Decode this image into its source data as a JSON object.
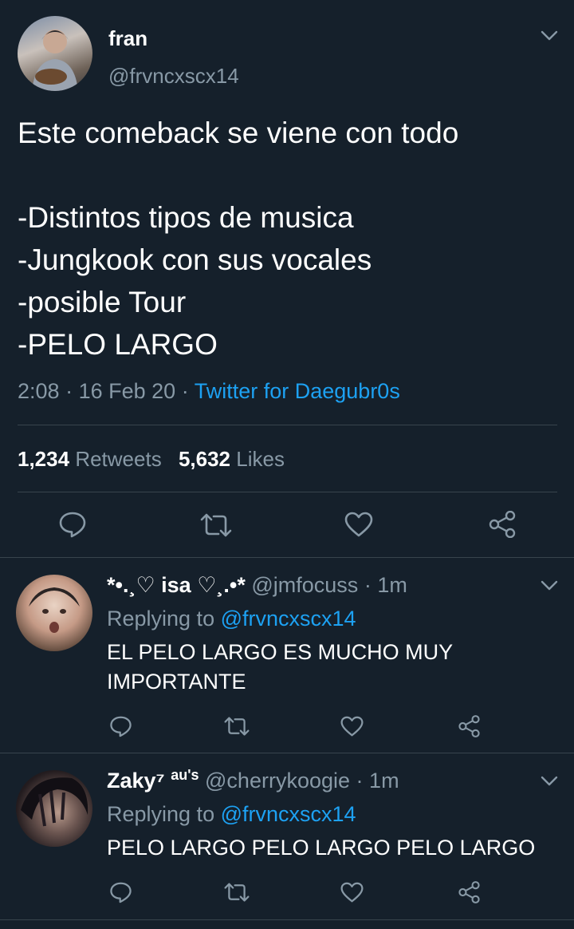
{
  "main_tweet": {
    "author_name": "fran",
    "author_handle": "@frvncxscx14",
    "text_line1": "Este comeback se viene con todo",
    "text_line2": "-Distintos tipos de musica",
    "text_line3": "-Jungkook con sus vocales",
    "text_line4": "-posible Tour",
    "text_line5": "-PELO LARGO",
    "time": "2:08",
    "date": "16 Feb 20",
    "separator": "·",
    "source": "Twitter for Daegubr0s",
    "retweets_count": "1,234",
    "retweets_label": "Retweets",
    "likes_count": "5,632",
    "likes_label": "Likes"
  },
  "replies": [
    {
      "author_name": "*•.¸♡ isa ♡¸.•*",
      "author_handle": "@jmfocuss",
      "separator": "·",
      "time_ago": "1m",
      "replying_label": "Replying to",
      "replying_handle": "@frvncxscx14",
      "text_line1": "EL PELO LARGO ES MUCHO MUY",
      "text_line2": "IMPORTANTE"
    },
    {
      "author_name": "Zaky⁷",
      "author_badge": "au's",
      "author_handle": "@cherrykoogie",
      "separator": "·",
      "time_ago": "1m",
      "replying_label": "Replying to",
      "replying_handle": "@frvncxscx14",
      "text_line1": "PELO LARGO PELO LARGO PELO LARGO"
    }
  ],
  "colors": {
    "background": "#15202b",
    "muted_text": "#8899a6",
    "link_blue": "#1da1f2",
    "divider": "#38444d"
  },
  "icons": {
    "menu": "chevron-down-icon",
    "reply": "reply-icon",
    "retweet": "retweet-icon",
    "like": "heart-icon",
    "share": "share-icon"
  }
}
